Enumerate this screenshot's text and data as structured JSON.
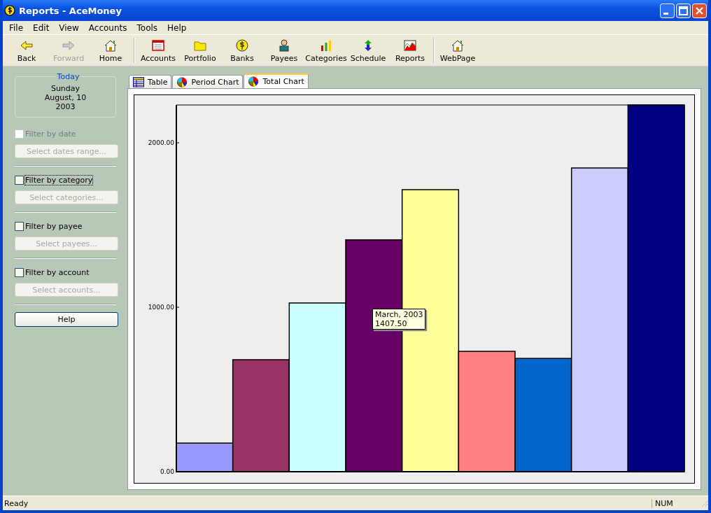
{
  "window": {
    "title": "Reports - AceMoney"
  },
  "menu": [
    "File",
    "Edit",
    "View",
    "Accounts",
    "Tools",
    "Help"
  ],
  "toolbar": [
    {
      "label": "Back",
      "disabled": false
    },
    {
      "label": "Forward",
      "disabled": true
    },
    {
      "label": "Home",
      "disabled": false
    },
    {
      "label": "Accounts",
      "disabled": false
    },
    {
      "label": "Portfolio",
      "disabled": false
    },
    {
      "label": "Banks",
      "disabled": false
    },
    {
      "label": "Payees",
      "disabled": false
    },
    {
      "label": "Categories",
      "disabled": false
    },
    {
      "label": "Schedule",
      "disabled": false
    },
    {
      "label": "Reports",
      "disabled": false
    },
    {
      "label": "WebPage",
      "disabled": false
    }
  ],
  "sidebar": {
    "today": {
      "legend": "Today",
      "lines": [
        "Sunday",
        "August, 10",
        "2003"
      ]
    },
    "filters": [
      {
        "label": "Filter by date",
        "checked": false,
        "disabled": true,
        "focused": false,
        "button": "Select dates range...",
        "button_disabled": true
      },
      {
        "label": "Filter by category",
        "checked": false,
        "disabled": false,
        "focused": true,
        "button": "Select categories...",
        "button_disabled": true
      },
      {
        "label": "Filter by payee",
        "checked": false,
        "disabled": false,
        "focused": false,
        "button": "Select payees...",
        "button_disabled": true
      },
      {
        "label": "Filter by account",
        "checked": false,
        "disabled": false,
        "focused": false,
        "button": "Select accounts...",
        "button_disabled": true
      }
    ],
    "help_button": "Help"
  },
  "tabs": [
    {
      "label": "Table",
      "selected": false
    },
    {
      "label": "Period Chart",
      "selected": false
    },
    {
      "label": "Total Chart",
      "selected": true
    }
  ],
  "chart": {
    "chart_data": {
      "type": "bar",
      "ylim": [
        0,
        2230
      ],
      "yticks": [
        {
          "value": 0,
          "label": "0.00"
        },
        {
          "value": 1000,
          "label": "1000.00"
        },
        {
          "value": 2000,
          "label": "2000.00"
        }
      ],
      "series": [
        {
          "colors": [
            "#9999ff",
            "#993366",
            "#ccffff",
            "#660066",
            "#ffff99",
            "#ff8080",
            "#0066cc",
            "#ccccff",
            "#000080"
          ],
          "values": [
            174,
            681,
            1026,
            1410,
            1715,
            732,
            689,
            1847,
            2230
          ]
        }
      ]
    },
    "tooltip": {
      "title": "March, 2003",
      "value": "1407.50"
    }
  },
  "status_bar": {
    "text": "Ready",
    "indicator": "NUM"
  }
}
